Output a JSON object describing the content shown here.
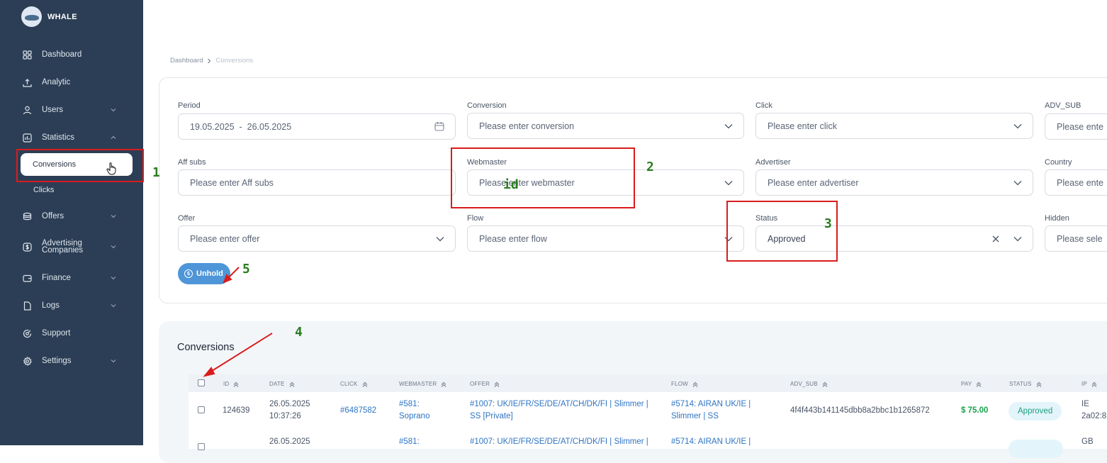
{
  "app": {
    "name": "WHALE"
  },
  "sidebar": {
    "items": [
      {
        "label": "Dashboard",
        "icon": "grid-icon"
      },
      {
        "label": "Analytic",
        "icon": "analytic-icon"
      },
      {
        "label": "Users",
        "icon": "user-icon"
      },
      {
        "label": "Statistics",
        "icon": "chart-icon"
      },
      {
        "label": "Offers",
        "icon": "stack-icon"
      },
      {
        "label": "Advertising Companies",
        "icon": "dollar-icon"
      },
      {
        "label": "Finance",
        "icon": "wallet-icon"
      },
      {
        "label": "Logs",
        "icon": "file-icon"
      },
      {
        "label": "Support",
        "icon": "support-icon"
      },
      {
        "label": "Settings",
        "icon": "gear-icon"
      }
    ],
    "statistics_sub": {
      "active": "Conversions",
      "other": "Clicks"
    }
  },
  "breadcrumb": {
    "parent": "Dashboard",
    "current": "Conversions"
  },
  "filters": {
    "period": {
      "label": "Period",
      "value": "19.05.2025  -  26.05.2025"
    },
    "conversion": {
      "label": "Conversion",
      "placeholder": "Please enter conversion"
    },
    "click": {
      "label": "Click",
      "placeholder": "Please enter click"
    },
    "adv_sub": {
      "label": "ADV_SUB",
      "placeholder": "Please ente"
    },
    "aff_subs": {
      "label": "Aff subs",
      "placeholder": "Please enter Aff subs"
    },
    "webmaster": {
      "label": "Webmaster",
      "placeholder": "Please enter webmaster"
    },
    "advertiser": {
      "label": "Advertiser",
      "placeholder": "Please enter advertiser"
    },
    "country": {
      "label": "Country",
      "placeholder": "Please ente"
    },
    "offer": {
      "label": "Offer",
      "placeholder": "Please enter offer"
    },
    "flow": {
      "label": "Flow",
      "placeholder": "Please enter flow"
    },
    "status": {
      "label": "Status",
      "value": "Approved"
    },
    "hidden": {
      "label": "Hidden",
      "placeholder": "Please sele"
    }
  },
  "unhold_button": {
    "label": "Unhold"
  },
  "table": {
    "title": "Conversions",
    "columns": [
      "ID",
      "DATE",
      "CLICK",
      "WEBMASTER",
      "OFFER",
      "FLOW",
      "ADV_SUB",
      "PAY",
      "STATUS",
      "IP"
    ],
    "rows": [
      {
        "id": "124639",
        "date": "26.05.2025",
        "time": "10:37:26",
        "click": "#6487582",
        "webmaster_id": "#581:",
        "webmaster_name": "Soprano",
        "offer_line1": "#1007: UK/IE/FR/SE/DE/AT/CH/DK/FI | Slimmer |",
        "offer_line2": "SS [Private]",
        "flow_line1": "#5714: AIRAN UK/IE |",
        "flow_line2": "Slimmer | SS",
        "adv_sub": "4f4f443b141145dbb8a2bbc1b1265872",
        "pay": "$ 75.00",
        "status": "Approved",
        "ip_country": "IE",
        "ip": "2a02:8"
      },
      {
        "date": "26.05.2025",
        "webmaster_id": "#581:",
        "offer_line1": "#1007: UK/IE/FR/SE/DE/AT/CH/DK/FI | Slimmer |",
        "flow_line1": "#5714: AIRAN UK/IE |",
        "ip_country": "GB"
      }
    ]
  },
  "annotations": {
    "n1": "1",
    "n2": "2",
    "n3": "3",
    "n4": "4",
    "n5": "5",
    "id_note": "id",
    "color": "#d91c1c",
    "number_color": "#2a7d1e"
  }
}
